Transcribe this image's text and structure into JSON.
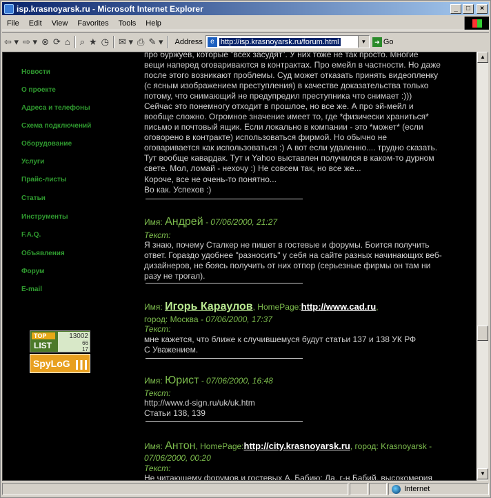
{
  "window": {
    "title": "isp.krasnoyarsk.ru - Microsoft Internet Explorer",
    "min": "_",
    "max": "□",
    "close": "×"
  },
  "menu": [
    "File",
    "Edit",
    "View",
    "Favorites",
    "Tools",
    "Help"
  ],
  "toolbar": {
    "address_label": "Address",
    "url": "http://isp.krasnoyarsk.ru/forum.html",
    "go_label": "Go"
  },
  "sidebar": {
    "items": [
      "Новости",
      "О проекте",
      "Адреса и телефоны",
      "Схема подключений",
      "Оборудование",
      "Услуги",
      "Прайс-листы",
      "Статьи",
      "Инструменты",
      "F.A.Q.",
      "Объявления",
      "Форум",
      "E-mail"
    ],
    "counter": {
      "top": "TOP",
      "list": "LIST",
      "n1": "13002",
      "n2": "66",
      "n3": "17"
    },
    "spylog": "SpyLoG"
  },
  "content": {
    "intro_lines": [
      "про буржуев, которые \"всех засудят\". У них тоже не так просто. Многие",
      "вещи наперед оговариваются в контрактах. Про емейл в частности. Но даже",
      "после этого возникают проблемы. Суд может отказать принять видеопленку",
      "(с ясным изображением преступления) в качестве доказательства только",
      "потому, что снимающий не предупредил преступника что снимает :)))",
      "Сейчас это понемногу отходит в прошлое, но все же. А про эй-мейл и",
      "вообще сложно. Огромное значение имеет то, где *физически храниться*",
      "письмо и почтовый ящик. Если локально в компании - это *может* (если",
      "оговорено в контракте) использоваться фирмой. Но обычно не",
      "оговаривается как использоваться :) А вот если удаленно.... трудно сказать.",
      "Тут вообще кавардак. Тут и Yahoo выставлен получился в каком-то дурном",
      "свете. Мол, ломай - нехочу :) Не совсем так, но все же..."
    ],
    "outro_lines": [
      "Короче, все не очень-то понятно...",
      "Во как. Успехов :)"
    ],
    "name_label": "Имя:",
    "text_label": "Текст:",
    "homepage_label": "HomePage:",
    "city_label": "город:",
    "posts": [
      {
        "name": "Андрей",
        "meta": " - 07/06/2000, 21:27",
        "lines": [
          "Я знаю, почему Сталкер не пишет в гостевые и форумы. Боится получить",
          "ответ. Гораздо удобнее \"разносить\" у себя на сайте разных начинающих веб-",
          "дизайнеров, не боясь получить от них отпор (серьезные фирмы он там ни",
          "разу не трогал)."
        ]
      },
      {
        "name": "Игорь Караулов",
        "homepage": "http://www.cad.ru",
        "city": "Москва",
        "meta": " - 07/06/2000, 17:37",
        "lines": [
          "мне кажется, что ближе к случившемуся будут статьи 137 и 138 УК РФ",
          "С Уважением."
        ]
      },
      {
        "name": "Юрист",
        "meta": " - 07/06/2000, 16:48",
        "lines": [
          "http://www.d-sign.ru/uk/uk.htm",
          "Статьи 138, 139"
        ]
      },
      {
        "name": "Антон",
        "homepage": "http://city.krasnoyarsk.ru",
        "city": "Krasnoyarsk",
        "meta": "07/06/2000, 00:20",
        "lines": [
          "Не читающему форумов и гостевых А. Бабию: Да, г-н Бабий, высокомерия"
        ]
      }
    ]
  },
  "status": {
    "zone": "Internet"
  }
}
